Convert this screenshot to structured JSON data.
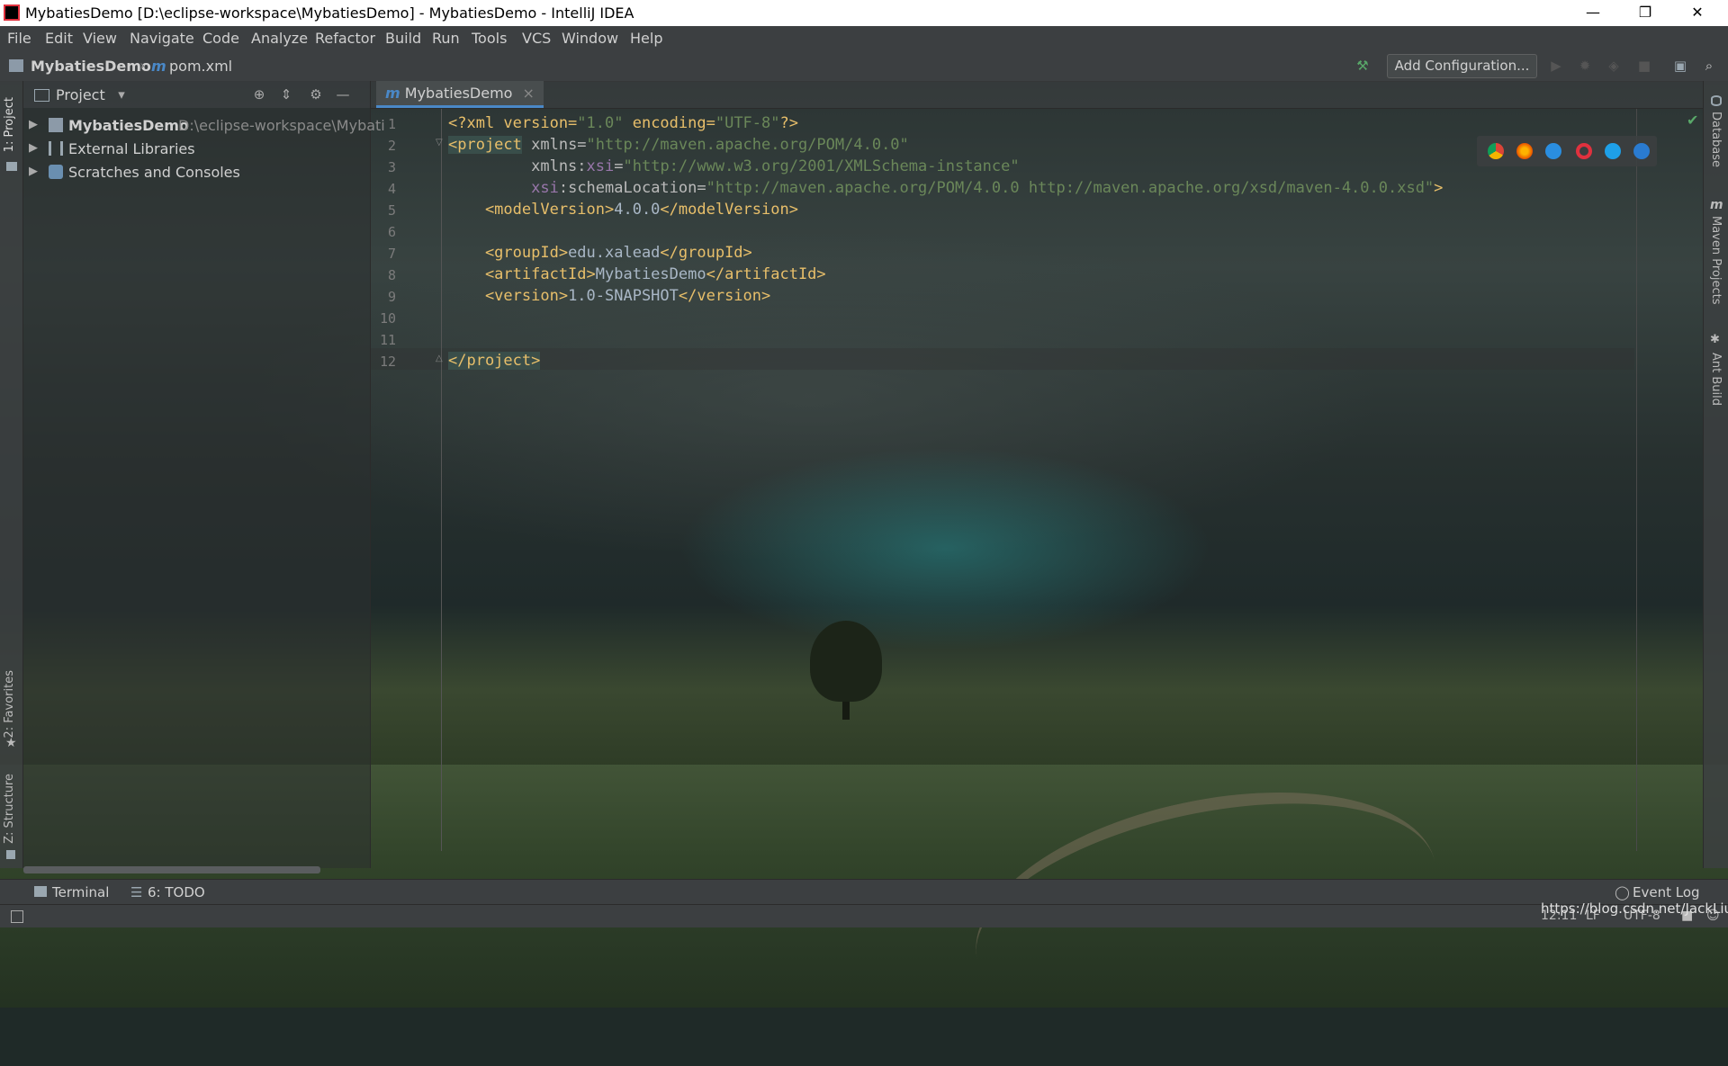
{
  "window": {
    "title": "MybatiesDemo [D:\\eclipse-workspace\\MybatiesDemo] - MybatiesDemo - IntelliJ IDEA",
    "minimize": "—",
    "maximize": "❐",
    "close": "✕"
  },
  "menu": [
    "File",
    "Edit",
    "View",
    "Navigate",
    "Code",
    "Analyze",
    "Refactor",
    "Build",
    "Run",
    "Tools",
    "VCS",
    "Window",
    "Help"
  ],
  "navbar": {
    "project": "MybatiesDemo",
    "file_icon": "m",
    "file": "pom.xml",
    "add_configuration": "Add Configuration..."
  },
  "left_tabs": {
    "project": "1: Project",
    "favorites": "2: Favorites",
    "structure": "Z: Structure"
  },
  "project_panel": {
    "title": "Project",
    "items": [
      {
        "label": "MybatiesDemo",
        "path": "D:\\eclipse-workspace\\Mybati"
      },
      {
        "label": "External Libraries"
      },
      {
        "label": "Scratches and Consoles"
      }
    ]
  },
  "editor": {
    "tab_icon": "m",
    "tab_label": "MybatiesDemo",
    "tab_close": "×",
    "line_numbers": [
      "1",
      "2",
      "3",
      "4",
      "5",
      "6",
      "7",
      "8",
      "9",
      "10",
      "11",
      "12"
    ]
  },
  "code": {
    "l1": {
      "a": "<?xml version=",
      "b": "\"1.0\"",
      "c": " encoding=",
      "d": "\"UTF-8\"",
      "e": "?>"
    },
    "l2": {
      "a": "<project",
      "b": " xmlns=",
      "c": "\"http://maven.apache.org/POM/4.0.0\""
    },
    "l3": {
      "a": "         xmlns:",
      "b": "xsi",
      "c": "=",
      "d": "\"http://www.w3.org/2001/XMLSchema-instance\""
    },
    "l4": {
      "a": "         ",
      "b": "xsi",
      "c": ":schemaLocation=",
      "d": "\"http://maven.apache.org/POM/4.0.0 http://maven.apache.org/xsd/maven-4.0.0.xsd\"",
      "e": ">"
    },
    "l5": {
      "a": "    <modelVersion>",
      "b": "4.0.0",
      "c": "</modelVersion>"
    },
    "l7": {
      "a": "    <groupId>",
      "b": "edu.xalead",
      "c": "</groupId>"
    },
    "l8": {
      "a": "    <artifactId>",
      "b": "MybatiesDemo",
      "c": "</artifactId>"
    },
    "l9": {
      "a": "    <version>",
      "b": "1.0-SNAPSHOT",
      "c": "</version>"
    },
    "l12": {
      "a": "</project>"
    }
  },
  "right_tabs": {
    "database": "Database",
    "maven": "Maven Projects",
    "ant": "Ant Build"
  },
  "bottom": {
    "terminal": "Terminal",
    "todo": "6: TODO",
    "event_log": "Event Log"
  },
  "status": {
    "position": "12:11",
    "line_sep": "LF",
    "encoding": "UTF-8"
  },
  "watermark": "https://blog.csdn.net/JackLiu",
  "colors": {
    "tag": "#e8bf6a",
    "value": "#6a8759",
    "namespace": "#9876aa",
    "background": "#2b2b2b"
  }
}
